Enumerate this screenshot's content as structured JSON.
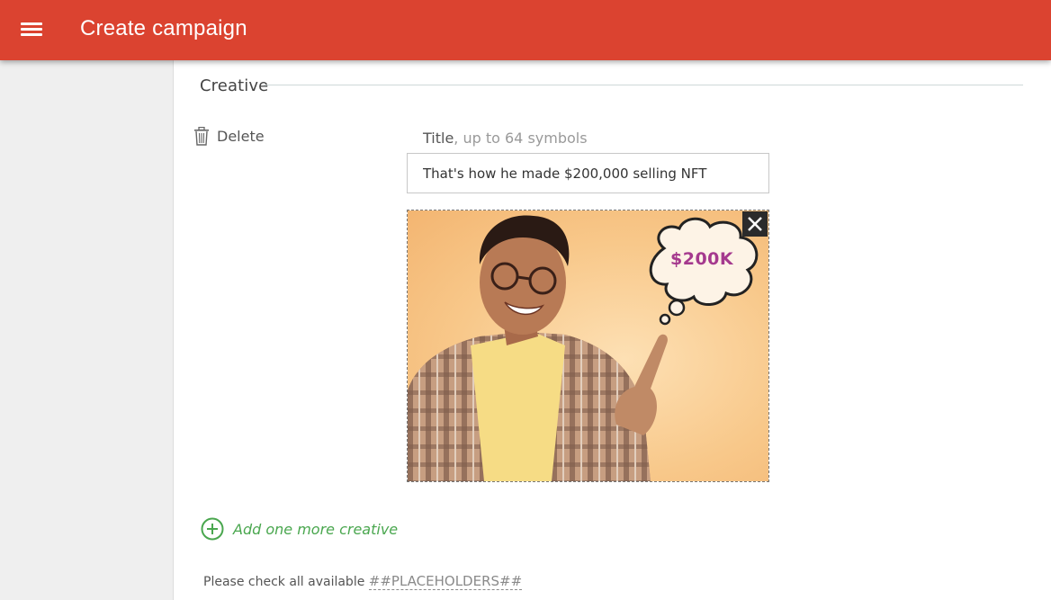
{
  "appbar": {
    "title": "Create campaign",
    "menu_icon": "hamburger-menu-icon",
    "color": "#db4330"
  },
  "section": {
    "legend": "Creative"
  },
  "creative": {
    "delete_label": "Delete",
    "delete_icon": "trash-icon",
    "title_label": "Title",
    "title_hint": ", up to 64 symbols",
    "title_value": "That's how he made $200,000 selling NFT",
    "image_text": "$200K",
    "remove_icon": "close-icon"
  },
  "add_creative": {
    "label": "Add one more creative",
    "icon": "plus-circle-icon",
    "color": "#4aa74f"
  },
  "footer": {
    "note": "Please check all available",
    "placeholders_link": "##PLACEHOLDERS##"
  }
}
